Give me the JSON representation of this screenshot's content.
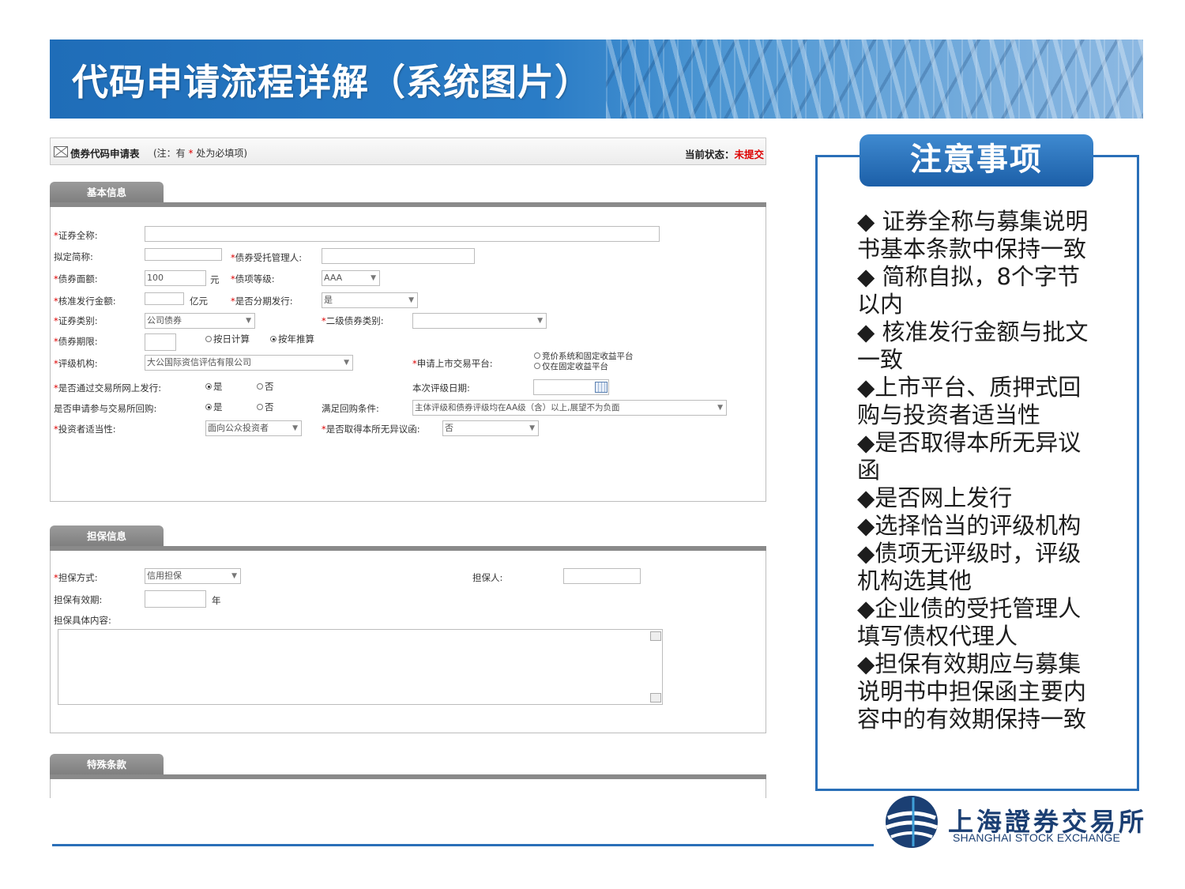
{
  "title": "代码申请流程详解（系统图片）",
  "form": {
    "title": "债券代码申请表",
    "note_prefix": "(注：有",
    "note_star": "*",
    "note_suffix": "处为必填项)",
    "status_label": "当前状态：",
    "status_value": "未提交"
  },
  "basic": {
    "tab": "基本信息",
    "full_name_label": "证券全称:",
    "short_name_label": "拟定简称:",
    "trustee_label": "债券受托管理人:",
    "face_value_label": "债券面额:",
    "face_value": "100",
    "face_value_unit": "元",
    "rating_label": "债项等级:",
    "rating_value": "AAA",
    "amount_label": "核准发行金额:",
    "amount_unit": "亿元",
    "installment_label": "是否分期发行:",
    "installment_value": "是",
    "category_label": "证券类别:",
    "category_value": "公司债券",
    "subcategory_label": "二级债券类别:",
    "term_label": "债券期限:",
    "term_opt_day": "按日计算",
    "term_opt_year": "按年推算",
    "agency_label": "评级机构:",
    "agency_value": "大公国际资信评估有限公司",
    "platform_label": "申请上市交易平台:",
    "platform_opt1": "竞价系统和固定收益平台",
    "platform_opt2": "仅在固定收益平台",
    "online_label": "是否通过交易所网上发行:",
    "yes": "是",
    "no": "否",
    "rating_date_label": "本次评级日期:",
    "repo_label": "是否申请参与交易所回购:",
    "repo_cond_label": "满足回购条件:",
    "repo_cond_value": "主体评级和债券评级均在AA级（含）以上,展望不为负面",
    "investor_label": "投资者适当性:",
    "investor_value": "面向公众投资者",
    "objection_label": "是否取得本所无异议函:",
    "objection_value": "否"
  },
  "guarantee": {
    "tab": "担保信息",
    "method_label": "担保方式:",
    "method_value": "信用担保",
    "guarantor_label": "担保人:",
    "period_label": "担保有效期:",
    "period_unit": "年",
    "content_label": "担保具体内容:"
  },
  "special": {
    "tab": "特殊条款"
  },
  "notes": {
    "title": "注意事项",
    "items": [
      "◆ 证券全称与募集说明书基本条款中保持一致",
      "◆ 简称自拟，8个字节以内",
      "◆ 核准发行金额与批文一致",
      "◆上市平台、质押式回购与投资者适当性",
      "◆是否取得本所无异议函",
      "◆是否网上发行",
      "◆选择恰当的评级机构",
      "◆债项无评级时，评级机构选其他",
      "◆企业债的受托管理人填写债权代理人",
      "◆担保有效期应与募集说明书中担保函主要内容中的有效期保持一致"
    ]
  },
  "logo": {
    "cn": "上海證券交易所",
    "en": "SHANGHAI STOCK EXCHANGE"
  },
  "colors": {
    "brand_blue": "#2a6fb8",
    "required_red": "#dd0000",
    "tab_gray": "#8a8a8a"
  }
}
